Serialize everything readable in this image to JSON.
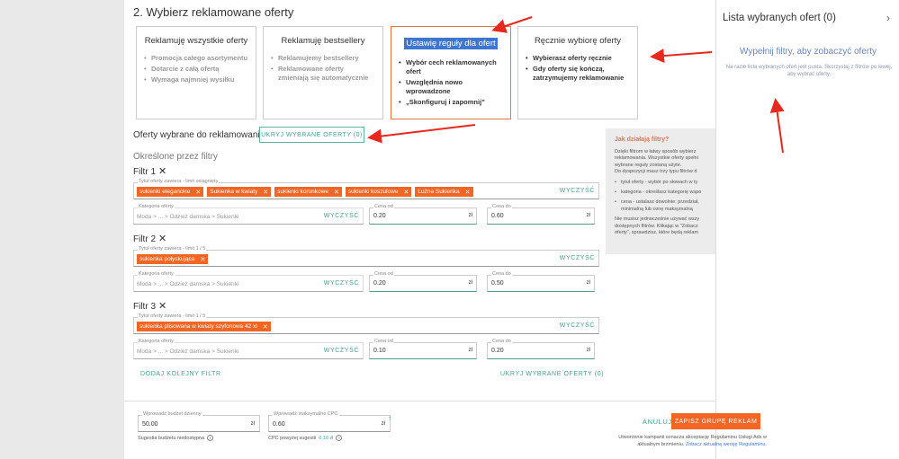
{
  "section_title": "2. Wybierz reklamowane oferty",
  "cards": [
    {
      "title": "Reklamuję wszystkie oferty",
      "items": [
        "Promocja całego asortymentu",
        "Dotarcie z całą ofertą",
        "Wymaga najmniej wysiłku"
      ]
    },
    {
      "title": "Reklamuję bestsellery",
      "items": [
        "Reklamujemy bestsellery",
        "Reklamowane oferty zmieniają się automatycznie"
      ]
    },
    {
      "title": "Ustawię reguły dla ofert",
      "items": [
        "Wybór cech reklamowanych ofert",
        "Uwzględnia nowo wprowadzone",
        "„Skonfiguruj i zapomnij”"
      ]
    },
    {
      "title": "Ręcznie wybiorę oferty",
      "items": [
        "Wybierasz oferty ręcznie",
        "Gdy oferty się kończą, zatrzymujemy reklamowanie"
      ]
    }
  ],
  "selected_label": "Oferty wybrane do reklamowania:",
  "hide_selected_button": "UKRYJ WYBRANE OFERTY (0)",
  "defined_by_filters": "Określone przez filtry",
  "clear_label": "WYCZYŚĆ",
  "price_from_label": "Cena od",
  "price_to_label": "Cena do",
  "currency": "zł",
  "category_label": "Kategoria oferty",
  "category_placeholder": "Moda > ... > Odzież damska > Sukienki",
  "filters": [
    {
      "title": "Filtr 1",
      "title_field_label": "Tytuł oferty zawiera - limit osiągnięty",
      "tags": [
        "sukienki eleganckie",
        "Sukienka w kwiaty",
        "sukienki koronkowe",
        "sukienki koszulowe",
        "Luźna Sukienka"
      ],
      "price_from": "0.20",
      "price_to": "0.60"
    },
    {
      "title": "Filtr 2",
      "title_field_label": "Tytuł oferty zawiera - limit 1 / 5",
      "tags": [
        "sukienka połyskująca"
      ],
      "price_from": "0.20",
      "price_to": "0.50"
    },
    {
      "title": "Filtr 3",
      "title_field_label": "Tytuł oferty zawiera - limit 1 / 5",
      "tags": [
        "sukienka plisowana w kwiaty szyfonowa 42 xl"
      ],
      "price_from": "0.10",
      "price_to": "0.20"
    }
  ],
  "add_filter_button": "DODAJ KOLEJNY FILTR",
  "hide_selected_button_2": "UKRYJ WYBRANE OFERTY (0)",
  "help": {
    "title": "Jak działają filtry?",
    "p1": [
      "Dzięki filtrom w łatwy sposób wybierz",
      "reklamowania. Wszystkie oferty spełni",
      "wybrane reguły zostaną użyte.",
      "Do dyspozycji masz trzy typu filtrów d"
    ],
    "li": [
      [
        "tytuł oferty - wybór po słowach w ty"
      ],
      [
        "kategoria - określasz kategorię wspo"
      ],
      [
        "cena - ustalasz dowolnie: przedział,",
        "minimalną lub cenę maksymalną"
      ]
    ],
    "p2": [
      "Nie musisz jednocześnie używać wszy",
      "dostępnych filtrów. Klikając w \"Zobacz",
      "oferty\", sprawdzisz, które będą reklam"
    ]
  },
  "side": {
    "title": "Lista wybranych ofert (0)",
    "empty_title": "Wypełnij filtry, aby zobaczyć oferty",
    "empty_text": "Na razie lista wybranych ofert jest pusta. Skorzystaj z filtrów po lewej, aby wybrać oferty."
  },
  "footer": {
    "budget_label": "Wprowadź budżet dzienny",
    "budget_value": "50.00",
    "budget_note": "Sugestia budżetu niedostępna",
    "cpc_label": "Wprowadź maksymalne CPC",
    "cpc_value": "0.60",
    "cpc_note_prefix": "CPC powyżej sugestii",
    "cpc_suggestion": "0,10 zł",
    "cancel": "ANULUJ",
    "save": "ZAPISZ GRUPĘ REKLAM",
    "terms_line1": "Utworzenie kampanii oznacza akceptację Regulaminu Usługi Ads w",
    "terms_line2_prefix": "aktualnym brzmieniu.",
    "terms_link": "Zobacz aktualną wersję Regulaminu."
  },
  "colors": {
    "accent": "#f26522",
    "teal": "#4a9d8f",
    "highlight": "#3c76d0",
    "annotation": "#e8281e"
  }
}
